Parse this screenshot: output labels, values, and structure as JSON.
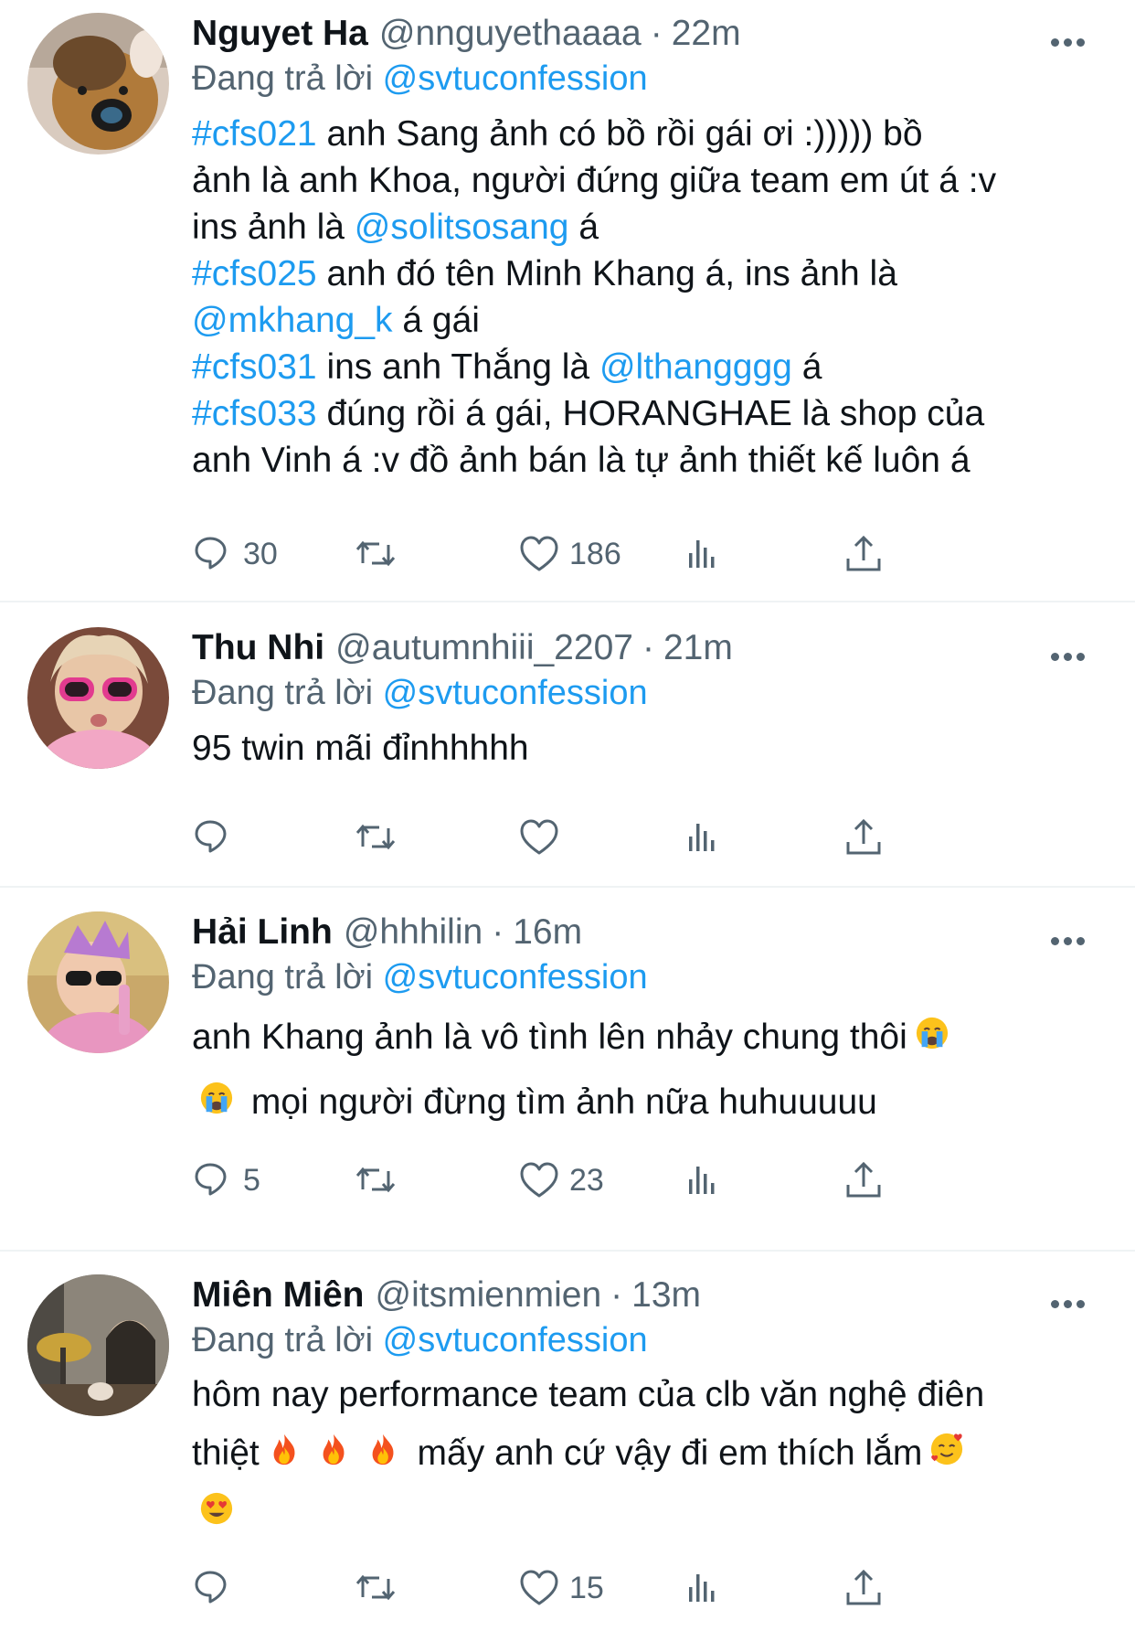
{
  "tweets": [
    {
      "name": "Nguyet Ha",
      "handle": "@nnguyethaaaa",
      "sep": "·",
      "time": "22m",
      "reply_prefix": "Đang trả lời",
      "reply_handle": "@svtuconfession",
      "lines": [
        [
          {
            "t": "#cfs021",
            "link": true
          },
          {
            "t": " anh Sang ảnh có bồ rồi gái ơi :))))) bồ",
            "link": false
          }
        ],
        [
          {
            "t": "ảnh là anh Khoa, người đứng giữa team em út á :v",
            "link": false
          }
        ],
        [
          {
            "t": "ins ảnh là ",
            "link": false
          },
          {
            "t": "@solitsosang",
            "link": true
          },
          {
            "t": " á",
            "link": false
          }
        ],
        [
          {
            "t": "#cfs025",
            "link": true
          },
          {
            "t": " anh đó tên Minh Khang á, ins ảnh là",
            "link": false
          }
        ],
        [
          {
            "t": "@mkhang_k",
            "link": true
          },
          {
            "t": " á gái",
            "link": false
          }
        ],
        [
          {
            "t": "#cfs031",
            "link": true
          },
          {
            "t": " ins anh Thắng là ",
            "link": false
          },
          {
            "t": "@lthangggg",
            "link": true
          },
          {
            "t": " á",
            "link": false
          }
        ],
        [
          {
            "t": "#cfs033",
            "link": true
          },
          {
            "t": " đúng rồi á gái, HORANGHAE là shop của",
            "link": false
          }
        ],
        [
          {
            "t": "anh Vinh á :v đồ ảnh bán là tự ảnh thiết kế luôn á",
            "link": false
          }
        ]
      ],
      "reply_count": "30",
      "retweet_count": "",
      "like_count": "186",
      "views_count": ""
    },
    {
      "name": "Thu Nhi",
      "handle": "@autumnhiii_2207",
      "sep": "·",
      "time": "21m",
      "reply_prefix": "Đang trả lời",
      "reply_handle": "@svtuconfession",
      "lines": [
        [
          {
            "t": "95 twin mãi đỉnhhhhh",
            "link": false
          }
        ]
      ],
      "reply_count": "",
      "retweet_count": "",
      "like_count": "",
      "views_count": ""
    },
    {
      "name": "Hải Linh",
      "handle": "@hhhilin",
      "sep": "·",
      "time": "16m",
      "reply_prefix": "Đang trả lời",
      "reply_handle": "@svtuconfession",
      "lines": [
        [
          {
            "t": "anh Khang ảnh là vô tình lên nhảy chung thôi",
            "link": false
          },
          {
            "emoji": "crying"
          }
        ],
        [
          {
            "emoji": "crying"
          },
          {
            "t": " mọi người đừng tìm ảnh nữa huhuuuuu",
            "link": false
          }
        ]
      ],
      "reply_count": "5",
      "retweet_count": "",
      "like_count": "23",
      "views_count": ""
    },
    {
      "name": "Miên Miên",
      "handle": "@itsmienmien",
      "sep": "·",
      "time": "13m",
      "reply_prefix": "Đang trả lời",
      "reply_handle": "@svtuconfession",
      "lines": [
        [
          {
            "t": "hôm nay performance team của clb văn nghệ điên",
            "link": false
          }
        ],
        [
          {
            "t": "thiệt",
            "link": false
          },
          {
            "emoji": "fire"
          },
          {
            "emoji": "fire"
          },
          {
            "emoji": "fire"
          },
          {
            "t": " mấy anh cứ vậy đi em thích lắm",
            "link": false
          },
          {
            "emoji": "smiling-hearts"
          }
        ],
        [
          {
            "emoji": "heart-eyes"
          }
        ]
      ],
      "reply_count": "",
      "retweet_count": "",
      "like_count": "15",
      "views_count": ""
    }
  ],
  "colors": {
    "link": "#1d9bf0",
    "muted": "#536471",
    "text": "#0f1419",
    "divider": "#eff3f4"
  }
}
